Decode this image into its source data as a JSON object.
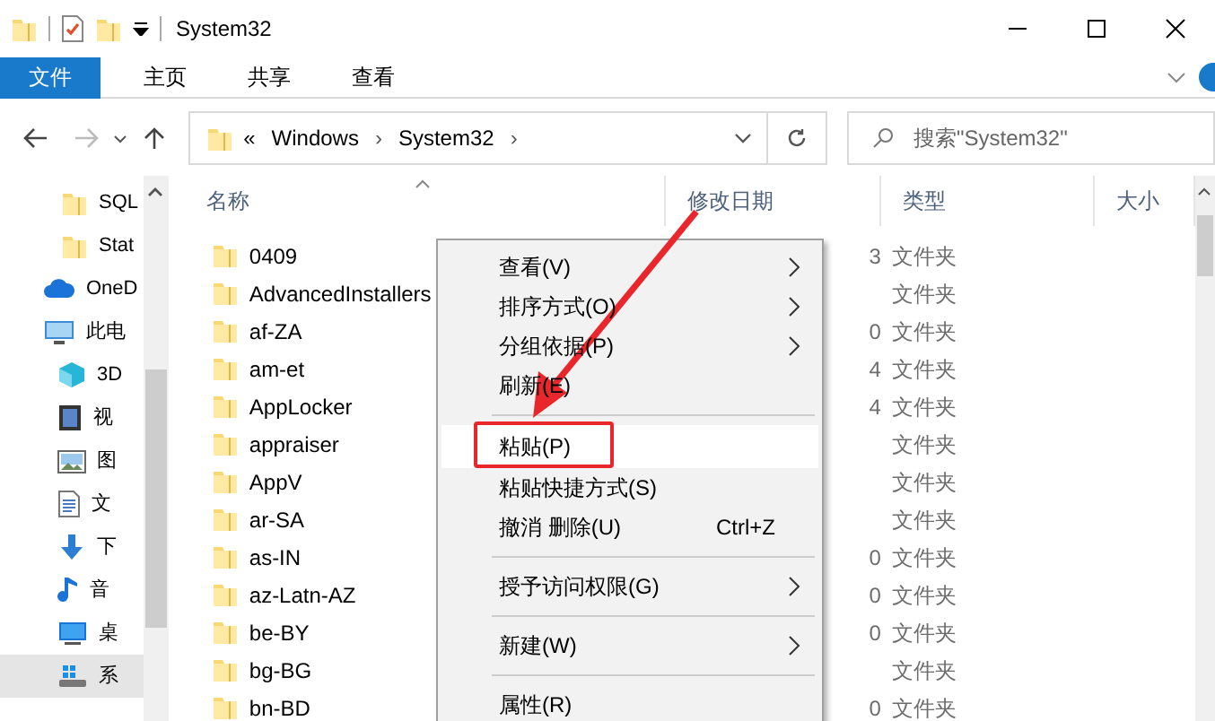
{
  "window": {
    "title": "System32"
  },
  "ribbon": {
    "tabs": [
      {
        "label": "文件",
        "selected": true
      },
      {
        "label": "主页",
        "selected": false
      },
      {
        "label": "共享",
        "selected": false
      },
      {
        "label": "查看",
        "selected": false
      }
    ]
  },
  "address": {
    "overflow": "«",
    "path": [
      "Windows",
      "System32"
    ],
    "separator": "›"
  },
  "search": {
    "placeholder": "搜索\"System32\""
  },
  "nav": {
    "items": [
      {
        "children": [
          {
            "label": "SQL",
            "kind": "folder",
            "selected": false
          },
          {
            "label": "Stat",
            "kind": "folder",
            "selected": false
          }
        ]
      },
      {
        "label": "OneD",
        "kind": "cloud",
        "selected": false
      },
      {
        "label": "此电",
        "kind": "pc",
        "selected": false,
        "children": [
          {
            "label": "3D",
            "kind": "cube",
            "selected": false
          },
          {
            "label": "视",
            "kind": "video",
            "selected": false
          },
          {
            "label": "图",
            "kind": "picture",
            "selected": false
          },
          {
            "label": "文",
            "kind": "document",
            "selected": false
          },
          {
            "label": "下",
            "kind": "download",
            "selected": false
          },
          {
            "label": "音",
            "kind": "music",
            "selected": false
          },
          {
            "label": "桌",
            "kind": "desktop",
            "selected": false
          },
          {
            "label": "系",
            "kind": "drive",
            "selected": true
          }
        ]
      }
    ]
  },
  "columns": [
    "名称",
    "修改日期",
    "类型",
    "大小"
  ],
  "rows": [
    {
      "name": "0409",
      "date": "3",
      "type": "文件夹"
    },
    {
      "name": "AdvancedInstallers",
      "type": "文件夹"
    },
    {
      "name": "af-ZA",
      "date": "0",
      "type": "文件夹"
    },
    {
      "name": "am-et",
      "date": "4",
      "type": "文件夹"
    },
    {
      "name": "AppLocker",
      "date": "4",
      "type": "文件夹"
    },
    {
      "name": "appraiser",
      "type": "文件夹"
    },
    {
      "name": "AppV",
      "type": "文件夹"
    },
    {
      "name": "ar-SA",
      "type": "文件夹"
    },
    {
      "name": "as-IN",
      "date": "0",
      "type": "文件夹"
    },
    {
      "name": "az-Latn-AZ",
      "date": "0",
      "type": "文件夹"
    },
    {
      "name": "be-BY",
      "date": "0",
      "type": "文件夹"
    },
    {
      "name": "bg-BG",
      "type": "文件夹"
    },
    {
      "name": "bn-BD",
      "date": "0",
      "type": "文件夹"
    }
  ],
  "context_menu": [
    {
      "kind": "item",
      "label": "查看(V)",
      "submenu": true,
      "selected": false
    },
    {
      "kind": "item",
      "label": "排序方式(O)",
      "submenu": true,
      "selected": false
    },
    {
      "kind": "item",
      "label": "分组依据(P)",
      "submenu": true,
      "selected": false
    },
    {
      "kind": "item",
      "label": "刷新(E)",
      "submenu": false,
      "selected": false
    },
    {
      "kind": "separator"
    },
    {
      "kind": "item",
      "label": "粘贴(P)",
      "submenu": false,
      "selected": true,
      "annotated": true
    },
    {
      "kind": "item",
      "label": "粘贴快捷方式(S)",
      "submenu": false,
      "selected": false
    },
    {
      "kind": "item",
      "label": "撤消 删除(U)",
      "shortcut": "Ctrl+Z",
      "submenu": false,
      "selected": false
    },
    {
      "kind": "separator"
    },
    {
      "kind": "item",
      "label": "授予访问权限(G)",
      "submenu": true,
      "selected": false
    },
    {
      "kind": "separator"
    },
    {
      "kind": "item",
      "label": "新建(W)",
      "submenu": true,
      "selected": false
    },
    {
      "kind": "separator"
    },
    {
      "kind": "item",
      "label": "属性(R)",
      "submenu": false,
      "selected": false
    }
  ]
}
